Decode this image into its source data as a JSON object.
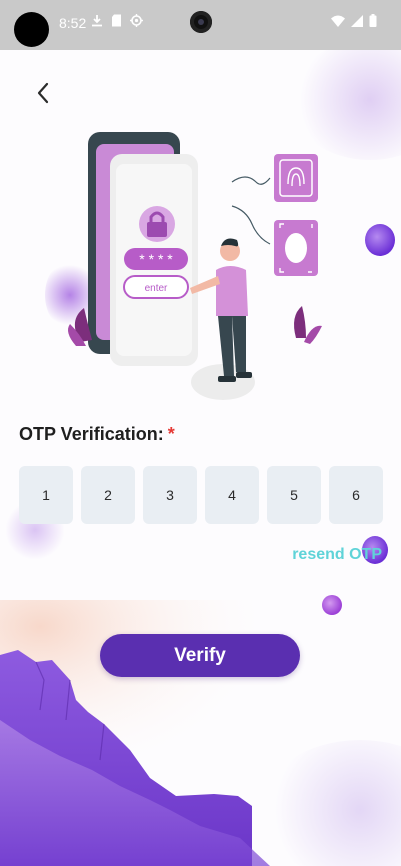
{
  "status_bar": {
    "time": "8:52"
  },
  "otp": {
    "title": "OTP Verification:",
    "required_mark": "*",
    "digits": [
      "1",
      "2",
      "3",
      "4",
      "5",
      "6"
    ],
    "resend_label": "resend OTP"
  },
  "verify_label": "Verify",
  "colors": {
    "primary": "#5a2fb0",
    "accent": "#5fd3d8",
    "required": "#e53935",
    "otp_box": "#e9eef3"
  }
}
